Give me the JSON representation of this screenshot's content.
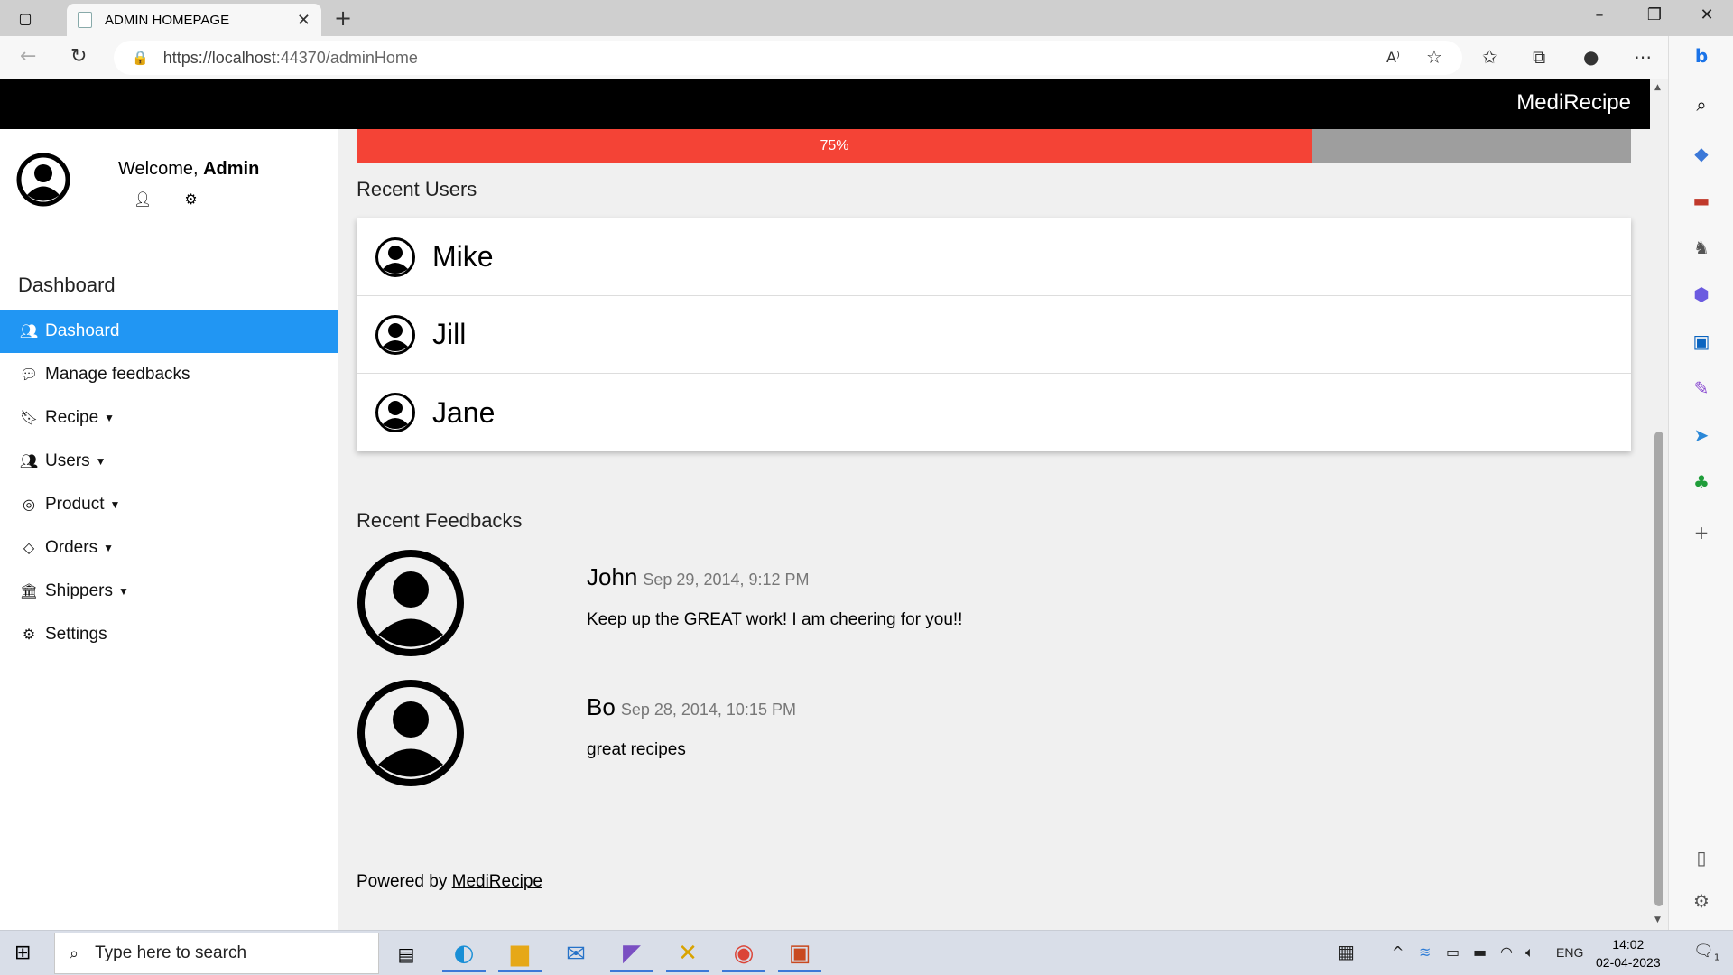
{
  "browser": {
    "tab_title": "ADMIN HOMEPAGE",
    "url_host": "https://localhost",
    "url_rest": ":44370/adminHome"
  },
  "navbar": {
    "brand": "MediRecipe"
  },
  "sidebar": {
    "welcome_prefix": "Welcome,",
    "welcome_name": "Admin",
    "section_title": "Dashboard",
    "items": [
      {
        "label": "Dashoard",
        "icon": "users-icon",
        "active": true
      },
      {
        "label": "Manage feedbacks",
        "icon": "comment-icon"
      },
      {
        "label": "Recipe",
        "icon": "bookmark-icon",
        "caret": true
      },
      {
        "label": "Users",
        "icon": "users-icon",
        "caret": true
      },
      {
        "label": "Product",
        "icon": "bullseye-icon",
        "caret": true
      },
      {
        "label": "Orders",
        "icon": "diamond-icon",
        "caret": true
      },
      {
        "label": "Shippers",
        "icon": "bank-icon",
        "caret": true
      },
      {
        "label": "Settings",
        "icon": "gear-icon"
      }
    ]
  },
  "progress": {
    "label": "75%",
    "value": 0.75,
    "fill_color": "#f44336",
    "track_color": "#9e9e9e"
  },
  "recent_users": {
    "title": "Recent Users",
    "users": [
      "Mike",
      "Jill",
      "Jane"
    ]
  },
  "recent_feedbacks": {
    "title": "Recent Feedbacks",
    "items": [
      {
        "name": "John",
        "date": "Sep 29, 2014, 9:12 PM",
        "message": "Keep up the GREAT work! I am cheering for you!!"
      },
      {
        "name": "Bo",
        "date": "Sep 28, 2014, 10:15 PM",
        "message": "great recipes"
      }
    ]
  },
  "footer": {
    "prefix": "Powered by",
    "link": "MediRecipe"
  },
  "taskbar": {
    "search_placeholder": "Type here to search",
    "lang": "ENG",
    "time": "14:02",
    "date": "02-04-2023",
    "notif_count": "1"
  },
  "colors": {
    "accent": "#2196f3",
    "navbar": "#000000"
  }
}
